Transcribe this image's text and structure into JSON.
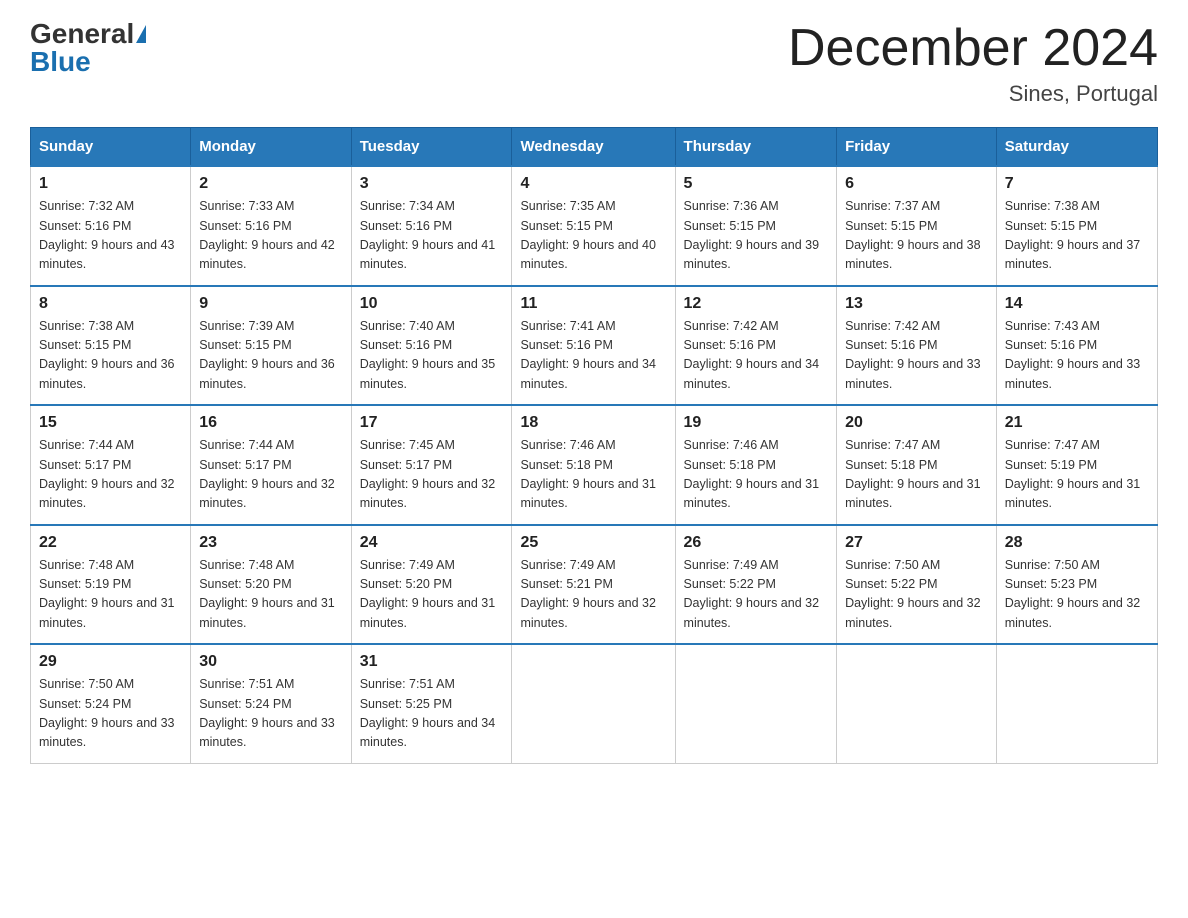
{
  "header": {
    "logo_general": "General",
    "logo_blue": "Blue",
    "title": "December 2024",
    "location": "Sines, Portugal"
  },
  "days_of_week": [
    "Sunday",
    "Monday",
    "Tuesday",
    "Wednesday",
    "Thursday",
    "Friday",
    "Saturday"
  ],
  "weeks": [
    [
      {
        "day": "1",
        "sunrise": "7:32 AM",
        "sunset": "5:16 PM",
        "daylight": "9 hours and 43 minutes."
      },
      {
        "day": "2",
        "sunrise": "7:33 AM",
        "sunset": "5:16 PM",
        "daylight": "9 hours and 42 minutes."
      },
      {
        "day": "3",
        "sunrise": "7:34 AM",
        "sunset": "5:16 PM",
        "daylight": "9 hours and 41 minutes."
      },
      {
        "day": "4",
        "sunrise": "7:35 AM",
        "sunset": "5:15 PM",
        "daylight": "9 hours and 40 minutes."
      },
      {
        "day": "5",
        "sunrise": "7:36 AM",
        "sunset": "5:15 PM",
        "daylight": "9 hours and 39 minutes."
      },
      {
        "day": "6",
        "sunrise": "7:37 AM",
        "sunset": "5:15 PM",
        "daylight": "9 hours and 38 minutes."
      },
      {
        "day": "7",
        "sunrise": "7:38 AM",
        "sunset": "5:15 PM",
        "daylight": "9 hours and 37 minutes."
      }
    ],
    [
      {
        "day": "8",
        "sunrise": "7:38 AM",
        "sunset": "5:15 PM",
        "daylight": "9 hours and 36 minutes."
      },
      {
        "day": "9",
        "sunrise": "7:39 AM",
        "sunset": "5:15 PM",
        "daylight": "9 hours and 36 minutes."
      },
      {
        "day": "10",
        "sunrise": "7:40 AM",
        "sunset": "5:16 PM",
        "daylight": "9 hours and 35 minutes."
      },
      {
        "day": "11",
        "sunrise": "7:41 AM",
        "sunset": "5:16 PM",
        "daylight": "9 hours and 34 minutes."
      },
      {
        "day": "12",
        "sunrise": "7:42 AM",
        "sunset": "5:16 PM",
        "daylight": "9 hours and 34 minutes."
      },
      {
        "day": "13",
        "sunrise": "7:42 AM",
        "sunset": "5:16 PM",
        "daylight": "9 hours and 33 minutes."
      },
      {
        "day": "14",
        "sunrise": "7:43 AM",
        "sunset": "5:16 PM",
        "daylight": "9 hours and 33 minutes."
      }
    ],
    [
      {
        "day": "15",
        "sunrise": "7:44 AM",
        "sunset": "5:17 PM",
        "daylight": "9 hours and 32 minutes."
      },
      {
        "day": "16",
        "sunrise": "7:44 AM",
        "sunset": "5:17 PM",
        "daylight": "9 hours and 32 minutes."
      },
      {
        "day": "17",
        "sunrise": "7:45 AM",
        "sunset": "5:17 PM",
        "daylight": "9 hours and 32 minutes."
      },
      {
        "day": "18",
        "sunrise": "7:46 AM",
        "sunset": "5:18 PM",
        "daylight": "9 hours and 31 minutes."
      },
      {
        "day": "19",
        "sunrise": "7:46 AM",
        "sunset": "5:18 PM",
        "daylight": "9 hours and 31 minutes."
      },
      {
        "day": "20",
        "sunrise": "7:47 AM",
        "sunset": "5:18 PM",
        "daylight": "9 hours and 31 minutes."
      },
      {
        "day": "21",
        "sunrise": "7:47 AM",
        "sunset": "5:19 PM",
        "daylight": "9 hours and 31 minutes."
      }
    ],
    [
      {
        "day": "22",
        "sunrise": "7:48 AM",
        "sunset": "5:19 PM",
        "daylight": "9 hours and 31 minutes."
      },
      {
        "day": "23",
        "sunrise": "7:48 AM",
        "sunset": "5:20 PM",
        "daylight": "9 hours and 31 minutes."
      },
      {
        "day": "24",
        "sunrise": "7:49 AM",
        "sunset": "5:20 PM",
        "daylight": "9 hours and 31 minutes."
      },
      {
        "day": "25",
        "sunrise": "7:49 AM",
        "sunset": "5:21 PM",
        "daylight": "9 hours and 32 minutes."
      },
      {
        "day": "26",
        "sunrise": "7:49 AM",
        "sunset": "5:22 PM",
        "daylight": "9 hours and 32 minutes."
      },
      {
        "day": "27",
        "sunrise": "7:50 AM",
        "sunset": "5:22 PM",
        "daylight": "9 hours and 32 minutes."
      },
      {
        "day": "28",
        "sunrise": "7:50 AM",
        "sunset": "5:23 PM",
        "daylight": "9 hours and 32 minutes."
      }
    ],
    [
      {
        "day": "29",
        "sunrise": "7:50 AM",
        "sunset": "5:24 PM",
        "daylight": "9 hours and 33 minutes."
      },
      {
        "day": "30",
        "sunrise": "7:51 AM",
        "sunset": "5:24 PM",
        "daylight": "9 hours and 33 minutes."
      },
      {
        "day": "31",
        "sunrise": "7:51 AM",
        "sunset": "5:25 PM",
        "daylight": "9 hours and 34 minutes."
      },
      null,
      null,
      null,
      null
    ]
  ]
}
